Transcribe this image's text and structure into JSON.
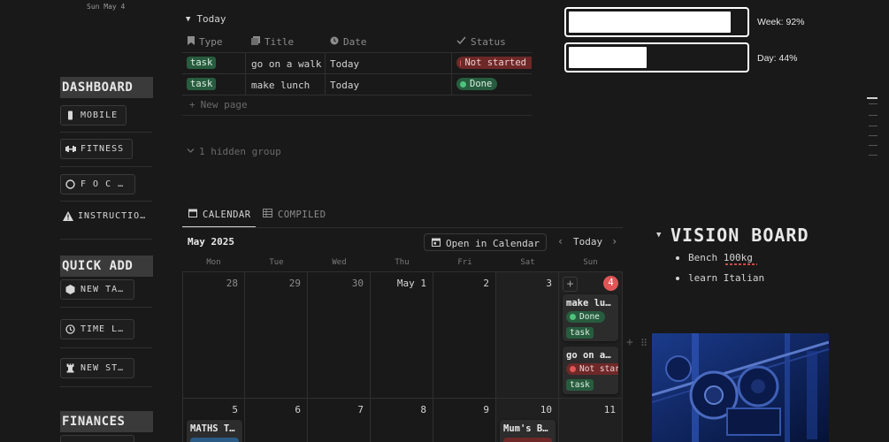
{
  "sidebar": {
    "top_date": "Sun May 4",
    "dashboard_title": "DASHBOARD",
    "dashboard_items": [
      {
        "label": "MOBILE",
        "icon": "phone-icon"
      },
      {
        "label": "FITNESS",
        "icon": "dumbbell-icon"
      },
      {
        "label": "F O C …",
        "icon": "circle-icon"
      },
      {
        "label": "INSTRUCTIO…",
        "icon": "warning-icon"
      }
    ],
    "quick_add_title": "QUICK ADD",
    "quick_add_items": [
      {
        "label": "NEW TA…",
        "icon": "hexagon-icon"
      },
      {
        "label": "TIME L…",
        "icon": "clock-icon"
      },
      {
        "label": "NEW ST…",
        "icon": "chess-rook-icon"
      }
    ],
    "finances_title": "FINANCES"
  },
  "today_group": {
    "label": "Today",
    "columns": [
      "Type",
      "Title",
      "Date",
      "Status"
    ],
    "rows": [
      {
        "type": "task",
        "title": "go on a walk",
        "date": "Today",
        "status": "Not started",
        "status_color": "#6e2828"
      },
      {
        "type": "task",
        "title": "make lunch",
        "date": "Today",
        "status": "Done",
        "status_color": "#275c3e"
      }
    ],
    "new_page": "New page",
    "hidden_group": "1 hidden group"
  },
  "progress": {
    "week_label": "Week: 92%",
    "week_value": 0.92,
    "day_label": "Day: 44%",
    "day_value": 0.44
  },
  "calendar": {
    "tabs": [
      "CALENDAR",
      "COMPILED"
    ],
    "active_tab": "CALENDAR",
    "month": "May 2025",
    "open_in_calendar": "Open in Calendar",
    "today_btn": "Today",
    "weekdays": [
      "Mon",
      "Tue",
      "Wed",
      "Thu",
      "Fri",
      "Sat",
      "Sun"
    ],
    "week1": [
      "28",
      "29",
      "30",
      "May 1",
      "2",
      "3",
      "4"
    ],
    "week2": [
      "5",
      "6",
      "7",
      "8",
      "9",
      "10",
      "11"
    ],
    "today_badge": "4",
    "events_sun4": [
      {
        "title": "make lu…",
        "status": "Done",
        "type": "task"
      },
      {
        "title": "go on a…",
        "status": "Not star",
        "type": "task"
      }
    ],
    "event_mon5": "MATHS T…",
    "event_sat10": "Mum's B…"
  },
  "vision": {
    "title": "VISION BOARD",
    "items": [
      "Bench 100kg",
      "learn Italian"
    ]
  },
  "colors": {
    "background": "#191919",
    "green_tag": "#275c3e",
    "red_pill": "#6e2828",
    "today_badge": "#e05555"
  }
}
